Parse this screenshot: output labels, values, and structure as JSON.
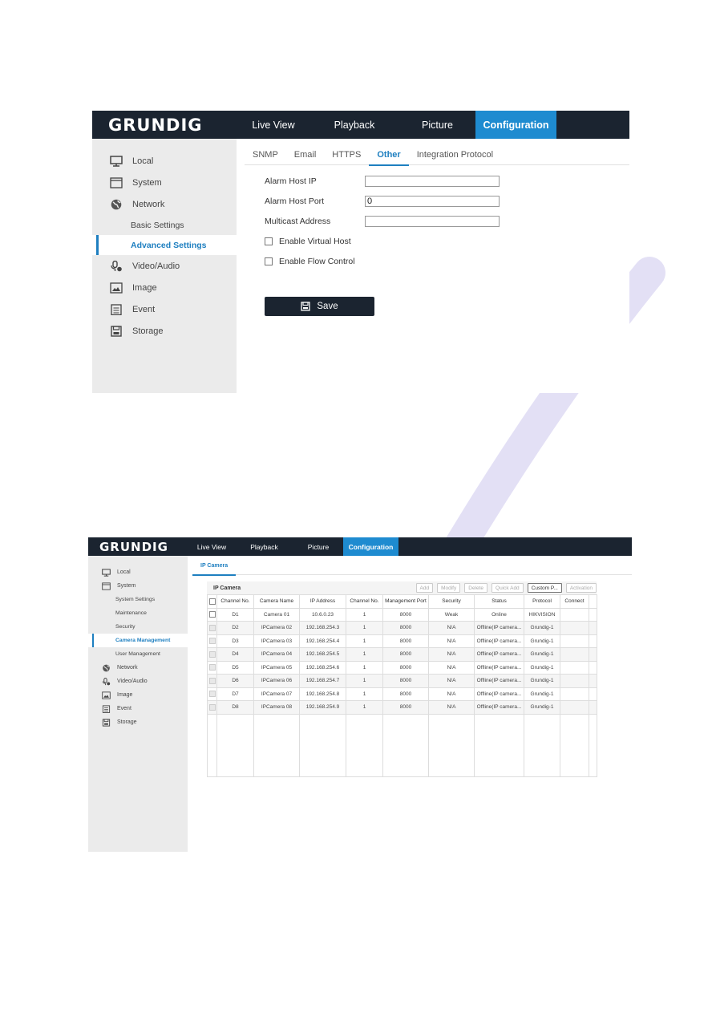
{
  "panel1": {
    "logo": "GRUNDIG",
    "nav": [
      {
        "label": "Live View",
        "active": false
      },
      {
        "label": "Playback",
        "active": false
      },
      {
        "label": "Picture",
        "active": false
      },
      {
        "label": "Configuration",
        "active": true
      }
    ],
    "sidebar": {
      "items": [
        {
          "label": "Local",
          "icon": "monitor-icon"
        },
        {
          "label": "System",
          "icon": "window-icon"
        },
        {
          "label": "Network",
          "icon": "globe-icon"
        }
      ],
      "network_sub": [
        {
          "label": "Basic Settings",
          "active": false
        },
        {
          "label": "Advanced Settings",
          "active": true
        }
      ],
      "items_after": [
        {
          "label": "Video/Audio",
          "icon": "video-audio-icon"
        },
        {
          "label": "Image",
          "icon": "image-icon"
        },
        {
          "label": "Event",
          "icon": "event-icon"
        },
        {
          "label": "Storage",
          "icon": "storage-icon"
        }
      ]
    },
    "tabs": [
      {
        "label": "SNMP",
        "active": false
      },
      {
        "label": "Email",
        "active": false
      },
      {
        "label": "HTTPS",
        "active": false
      },
      {
        "label": "Other",
        "active": true
      },
      {
        "label": "Integration Protocol",
        "active": false
      }
    ],
    "form": {
      "alarm_host_ip": {
        "label": "Alarm Host IP",
        "value": ""
      },
      "alarm_host_port": {
        "label": "Alarm Host Port",
        "value": "0"
      },
      "multicast_address": {
        "label": "Multicast Address",
        "value": ""
      },
      "enable_virtual_host": {
        "label": "Enable Virtual Host",
        "checked": false
      },
      "enable_flow_control": {
        "label": "Enable Flow Control",
        "checked": false
      }
    },
    "save_label": "Save"
  },
  "panel2": {
    "logo": "GRUNDIG",
    "nav": [
      {
        "label": "Live View",
        "active": false
      },
      {
        "label": "Playback",
        "active": false
      },
      {
        "label": "Picture",
        "active": false
      },
      {
        "label": "Configuration",
        "active": true
      }
    ],
    "sidebar": {
      "items_before": [
        {
          "label": "Local",
          "icon": "monitor-icon"
        },
        {
          "label": "System",
          "icon": "window-icon"
        }
      ],
      "system_sub": [
        {
          "label": "System Settings",
          "active": false
        },
        {
          "label": "Maintenance",
          "active": false
        },
        {
          "label": "Security",
          "active": false
        },
        {
          "label": "Camera Management",
          "active": true
        },
        {
          "label": "User Management",
          "active": false
        }
      ],
      "items_after": [
        {
          "label": "Network",
          "icon": "globe-icon"
        },
        {
          "label": "Video/Audio",
          "icon": "video-audio-icon"
        },
        {
          "label": "Image",
          "icon": "image-icon"
        },
        {
          "label": "Event",
          "icon": "event-icon"
        },
        {
          "label": "Storage",
          "icon": "storage-icon"
        }
      ]
    },
    "tabs": [
      {
        "label": "IP Camera",
        "active": true
      }
    ],
    "table_title": "IP Camera",
    "toolbar": [
      {
        "label": "Add",
        "enabled": false
      },
      {
        "label": "Modify",
        "enabled": false
      },
      {
        "label": "Delete",
        "enabled": false
      },
      {
        "label": "Quick Add",
        "enabled": false
      },
      {
        "label": "Custom P...",
        "enabled": true
      },
      {
        "label": "Activation",
        "enabled": false
      }
    ],
    "columns": [
      "Channel No.",
      "Camera Name",
      "IP Address",
      "Channel No.",
      "Management Port",
      "Security",
      "Status",
      "Protocol",
      "Connect"
    ],
    "rows": [
      {
        "channel": "D1",
        "name": "Camera 01",
        "ip": "10.6.0.23",
        "ch_no": "1",
        "port": "8000",
        "security": "Weak",
        "status": "Online",
        "protocol": "HIKVISION",
        "connect": "",
        "selectable": true
      },
      {
        "channel": "D2",
        "name": "IPCamera 02",
        "ip": "192.168.254.3",
        "ch_no": "1",
        "port": "8000",
        "security": "N/A",
        "status": "Offline(IP camera...",
        "protocol": "Grundig-1",
        "connect": "",
        "selectable": false
      },
      {
        "channel": "D3",
        "name": "IPCamera 03",
        "ip": "192.168.254.4",
        "ch_no": "1",
        "port": "8000",
        "security": "N/A",
        "status": "Offline(IP camera...",
        "protocol": "Grundig-1",
        "connect": "",
        "selectable": false
      },
      {
        "channel": "D4",
        "name": "IPCamera 04",
        "ip": "192.168.254.5",
        "ch_no": "1",
        "port": "8000",
        "security": "N/A",
        "status": "Offline(IP camera...",
        "protocol": "Grundig-1",
        "connect": "",
        "selectable": false
      },
      {
        "channel": "D5",
        "name": "IPCamera 05",
        "ip": "192.168.254.6",
        "ch_no": "1",
        "port": "8000",
        "security": "N/A",
        "status": "Offline(IP camera...",
        "protocol": "Grundig-1",
        "connect": "",
        "selectable": false
      },
      {
        "channel": "D6",
        "name": "IPCamera 06",
        "ip": "192.168.254.7",
        "ch_no": "1",
        "port": "8000",
        "security": "N/A",
        "status": "Offline(IP camera...",
        "protocol": "Grundig-1",
        "connect": "",
        "selectable": false
      },
      {
        "channel": "D7",
        "name": "IPCamera 07",
        "ip": "192.168.254.8",
        "ch_no": "1",
        "port": "8000",
        "security": "N/A",
        "status": "Offline(IP camera...",
        "protocol": "Grundig-1",
        "connect": "",
        "selectable": false
      },
      {
        "channel": "D8",
        "name": "IPCamera 08",
        "ip": "192.168.254.9",
        "ch_no": "1",
        "port": "8000",
        "security": "N/A",
        "status": "Offline(IP camera...",
        "protocol": "Grundig-1",
        "connect": "",
        "selectable": false
      }
    ]
  },
  "colors": {
    "topbar": "#1b2430",
    "accent": "#1e8bd0",
    "sidebar": "#ebebeb"
  }
}
